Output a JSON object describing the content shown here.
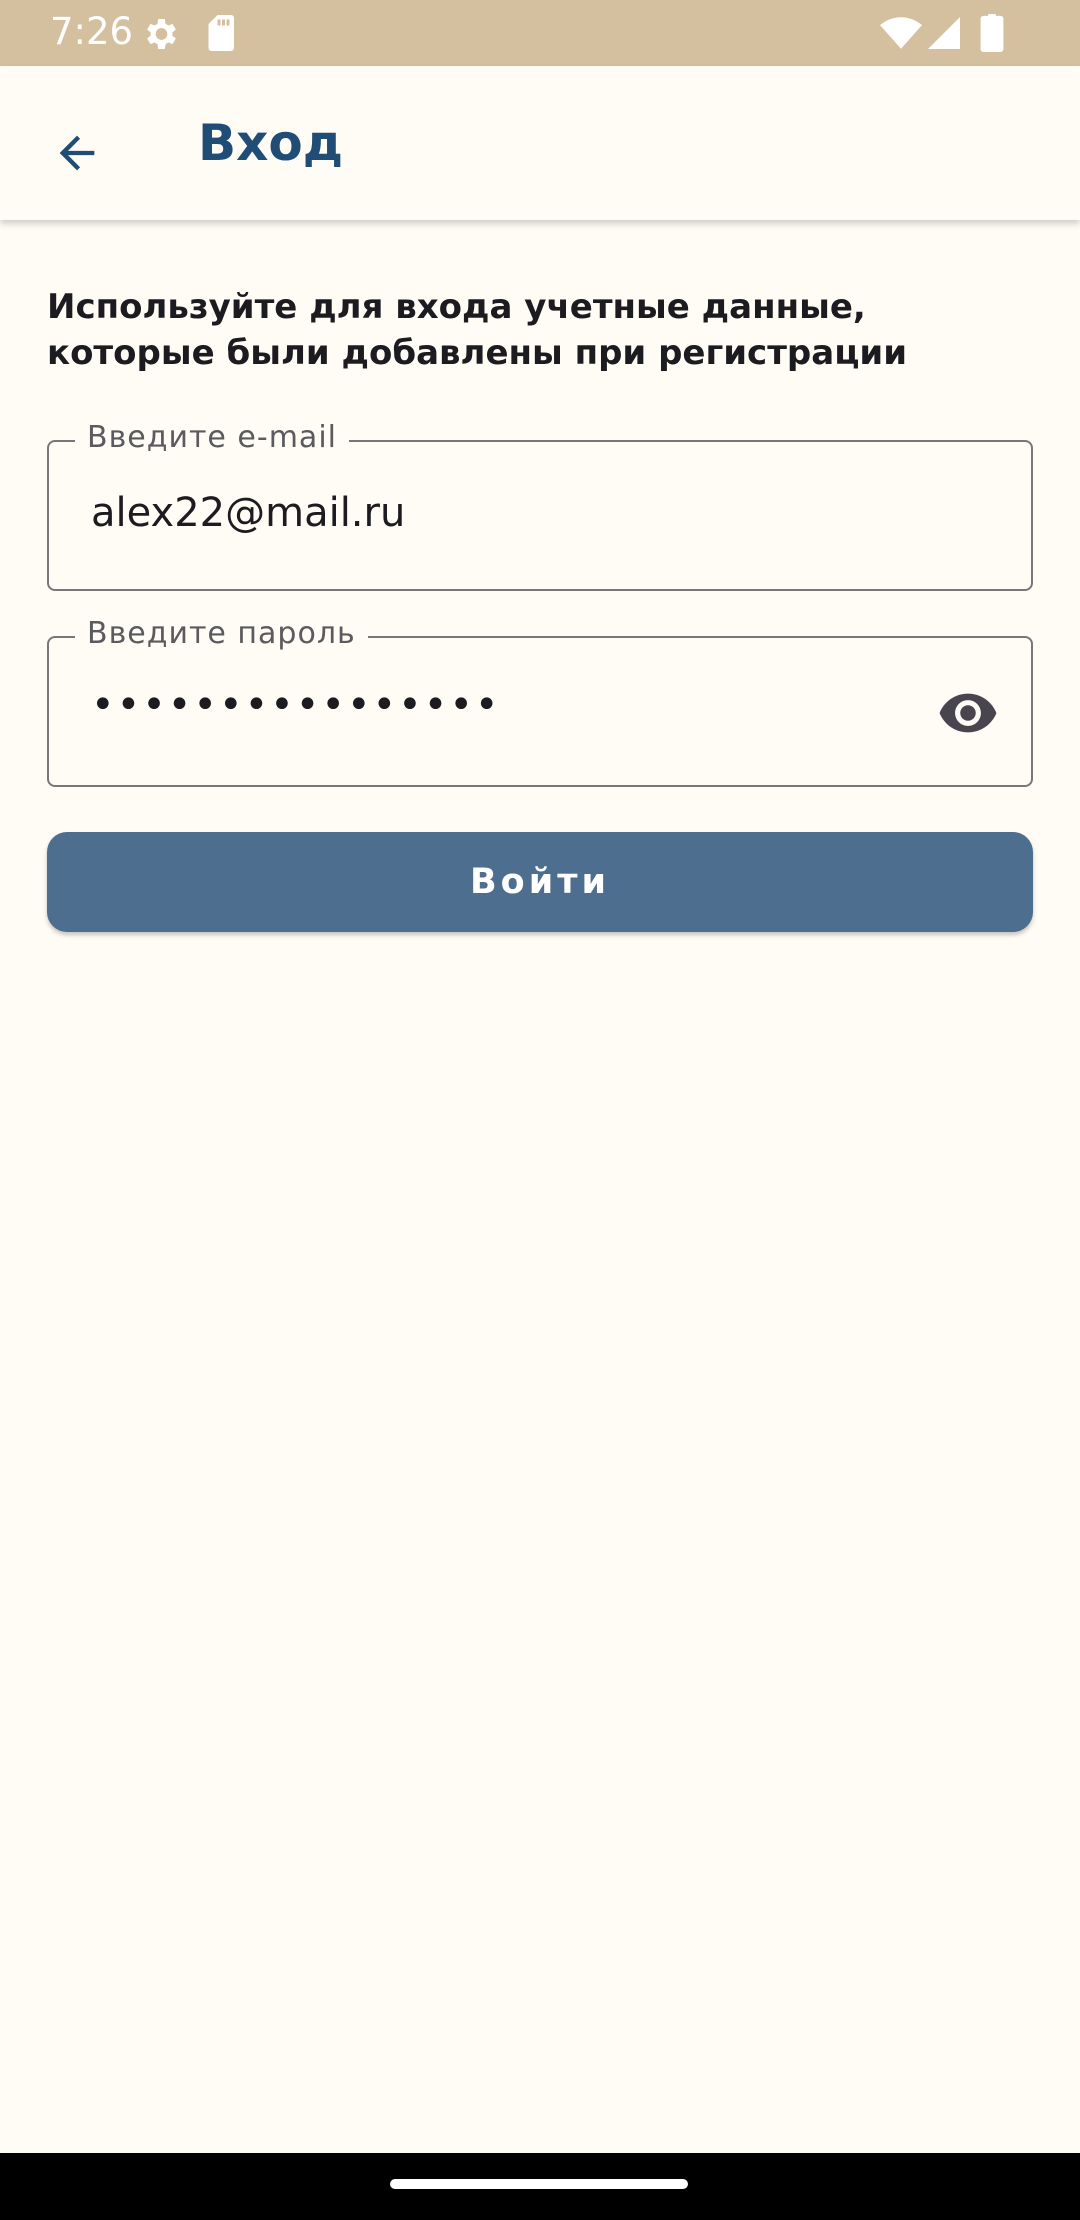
{
  "status_bar": {
    "time": "7:26",
    "icons": [
      "settings-icon",
      "sd-card-icon",
      "wifi-icon",
      "signal-icon",
      "battery-icon"
    ],
    "background_color": "#d4bf9e"
  },
  "app_bar": {
    "title": "Вход",
    "back_icon": "arrow-left-icon",
    "title_color": "#1f4d75"
  },
  "instruction_text": "Используйте для входа учетные данные, которые были добавлены при регистрации",
  "email_field": {
    "label": "Введите e-mail",
    "value": "alex22@mail.ru"
  },
  "password_field": {
    "label": "Введите пароль",
    "masked_value": "••••••••••••••••",
    "visibility_icon": "eye-icon"
  },
  "login_button": {
    "label": "Войти",
    "color": "#4e6e8f"
  },
  "colors": {
    "background": "#fffbf5",
    "text": "#1c1b1f",
    "outline": "#79757a"
  }
}
